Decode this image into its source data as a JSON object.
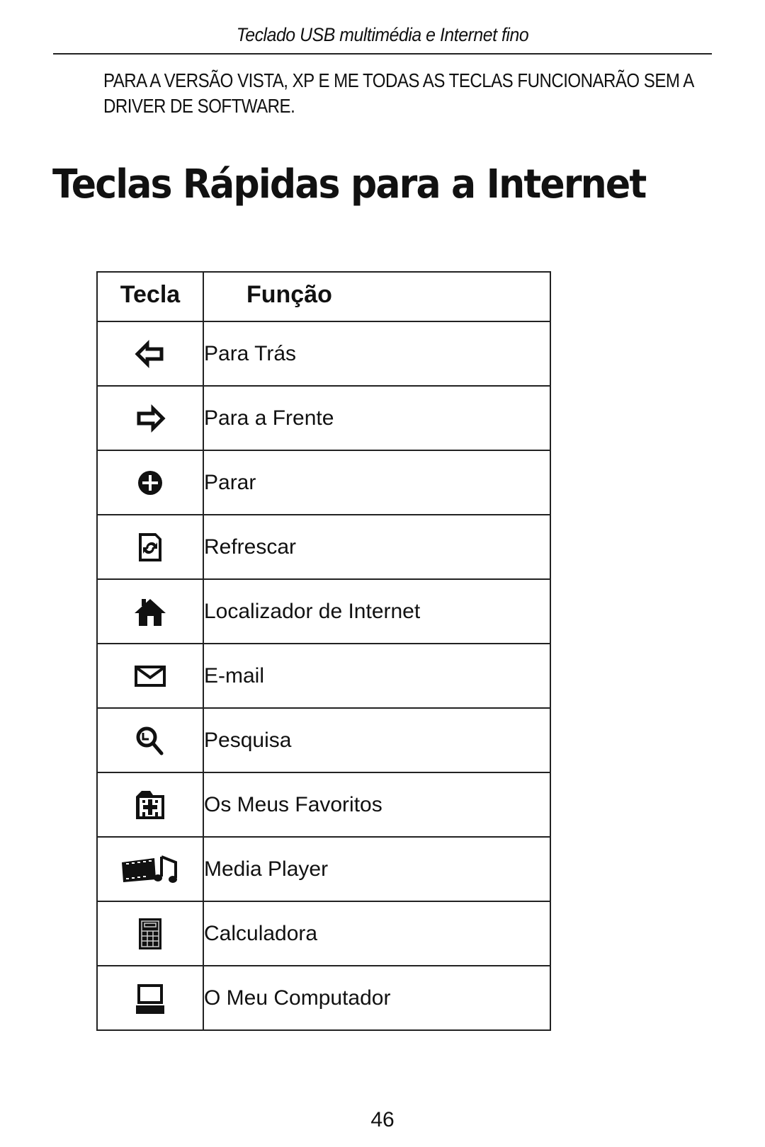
{
  "header": {
    "running_title": "Teclado USB multimédia e Internet fino"
  },
  "note": {
    "line1": "PARA A VERSÃO VISTA, XP E ME TODAS AS TECLAS FUNCIONARÃO SEM A",
    "line2": "DRIVER DE SOFTWARE."
  },
  "section": {
    "title": "Teclas Rápidas para a Internet"
  },
  "table": {
    "headers": {
      "key": "Tecla",
      "function": "Função"
    },
    "rows": [
      {
        "icon": "back-arrow-icon",
        "function": "Para Trás"
      },
      {
        "icon": "forward-arrow-icon",
        "function": "Para a Frente"
      },
      {
        "icon": "stop-icon",
        "function": "Parar"
      },
      {
        "icon": "refresh-icon",
        "function": "Refrescar"
      },
      {
        "icon": "home-icon",
        "function": "Localizador de Internet"
      },
      {
        "icon": "envelope-icon",
        "function": "E-mail"
      },
      {
        "icon": "magnifier-icon",
        "function": "Pesquisa"
      },
      {
        "icon": "favorites-folder-icon",
        "function": "Os Meus Favoritos"
      },
      {
        "icon": "media-player-icon",
        "function": "Media Player"
      },
      {
        "icon": "calculator-icon",
        "function": "Calculadora"
      },
      {
        "icon": "computer-icon",
        "function": "O Meu Computador"
      }
    ]
  },
  "footer": {
    "page_number": "46"
  }
}
